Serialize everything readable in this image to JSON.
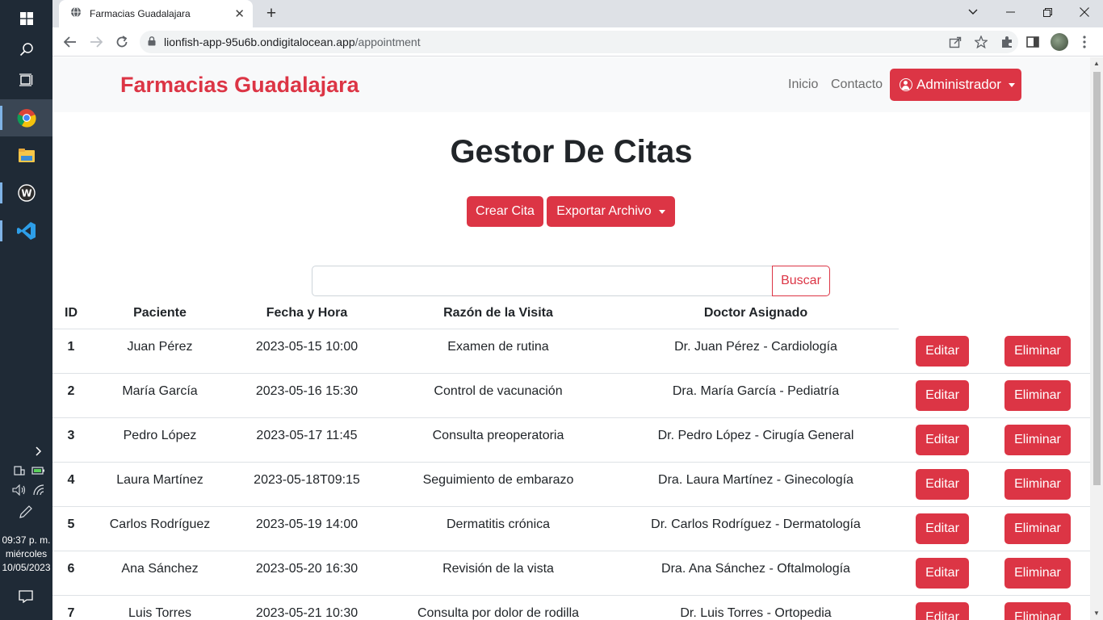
{
  "taskbar": {
    "icons": [
      "windows-start-icon",
      "search-icon",
      "task-view-icon",
      "chrome-icon",
      "file-explorer-icon",
      "app-w-icon",
      "vscode-icon"
    ],
    "clock": {
      "time": "09:37 p. m.",
      "day": "miércoles",
      "date": "10/05/2023"
    }
  },
  "browser": {
    "tab_title": "Farmacias Guadalajara",
    "url_host": "lionfish-app-95u6b.ondigitalocean.app",
    "url_path": "/appointment"
  },
  "navbar": {
    "brand": "Farmacias Guadalajara",
    "links": [
      "Inicio",
      "Contacto"
    ],
    "user_menu": "Administrador"
  },
  "main": {
    "title": "Gestor De Citas",
    "create_button": "Crear Cita",
    "export_button": "Exportar Archivo",
    "search_placeholder": "",
    "search_button": "Buscar"
  },
  "table": {
    "headers": [
      "ID",
      "Paciente",
      "Fecha y Hora",
      "Razón de la Visita",
      "Doctor Asignado"
    ],
    "edit_label": "Editar",
    "delete_label": "Eliminar",
    "rows": [
      {
        "id": "1",
        "paciente": "Juan Pérez",
        "fecha": "2023-05-15 10:00",
        "razon": "Examen de rutina",
        "doctor": "Dr. Juan Pérez - Cardiología"
      },
      {
        "id": "2",
        "paciente": "María García",
        "fecha": "2023-05-16 15:30",
        "razon": "Control de vacunación",
        "doctor": "Dra. María García - Pediatría"
      },
      {
        "id": "3",
        "paciente": "Pedro López",
        "fecha": "2023-05-17 11:45",
        "razon": "Consulta preoperatoria",
        "doctor": "Dr. Pedro López - Cirugía General"
      },
      {
        "id": "4",
        "paciente": "Laura Martínez",
        "fecha": "2023-05-18T09:15",
        "razon": "Seguimiento de embarazo",
        "doctor": "Dra. Laura Martínez - Ginecología"
      },
      {
        "id": "5",
        "paciente": "Carlos Rodríguez",
        "fecha": "2023-05-19 14:00",
        "razon": "Dermatitis crónica",
        "doctor": "Dr. Carlos Rodríguez - Dermatología"
      },
      {
        "id": "6",
        "paciente": "Ana Sánchez",
        "fecha": "2023-05-20 16:30",
        "razon": "Revisión de la vista",
        "doctor": "Dra. Ana Sánchez - Oftalmología"
      },
      {
        "id": "7",
        "paciente": "Luis Torres",
        "fecha": "2023-05-21 10:30",
        "razon": "Consulta por dolor de rodilla",
        "doctor": "Dr. Luis Torres - Ortopedia"
      }
    ]
  },
  "colors": {
    "accent": "#dc3545",
    "navbar_bg": "#f8f9fa",
    "taskbar_bg": "#1f2a36"
  }
}
